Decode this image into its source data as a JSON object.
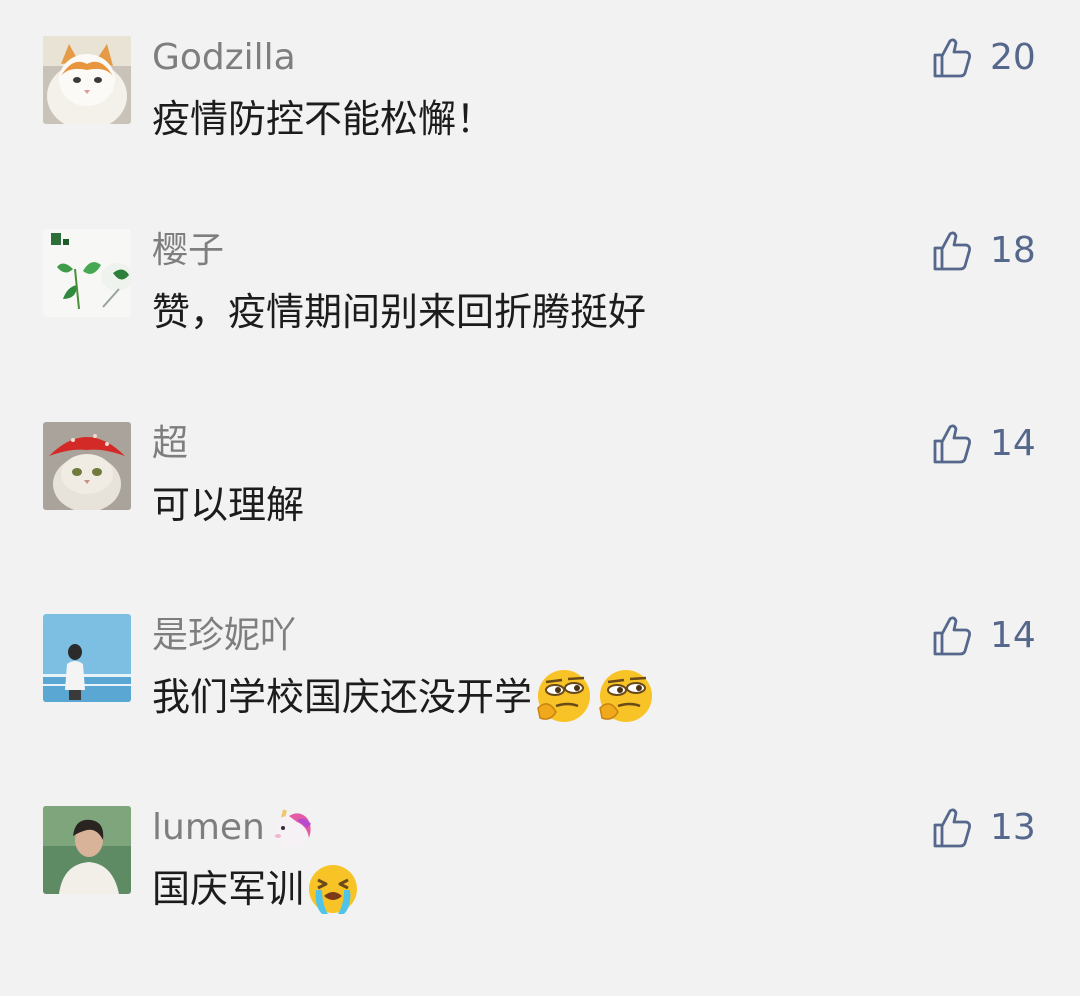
{
  "colors": {
    "background": "#f2f2f2",
    "username": "#7e7e7e",
    "comment_text": "#1c1c1c",
    "like": "#56678c"
  },
  "comments": [
    {
      "username": "Godzilla",
      "avatar": "orange-white-cat-photo",
      "text": "疫情防控不能松懈！",
      "likes": "20",
      "like_icon": "thumbs-up-icon"
    },
    {
      "username": "樱子",
      "avatar": "green-plant-leaves-photo",
      "text": "赞，疫情期间别来回折腾挺好",
      "likes": "18",
      "like_icon": "thumbs-up-icon"
    },
    {
      "username": "超",
      "avatar": "cat-with-red-bandana-photo",
      "text": "可以理解",
      "likes": "14",
      "like_icon": "thumbs-up-icon"
    },
    {
      "username": "是珍妮吖",
      "avatar": "girl-by-sea-illustration",
      "text": "我们学校国庆还没开学",
      "text_emojis": [
        "smirking-face-emoji",
        "smirking-face-emoji"
      ],
      "likes": "14",
      "like_icon": "thumbs-up-icon"
    },
    {
      "username": "lumen",
      "username_emoji": "unicorn-emoji",
      "avatar": "person-in-white-shirt-photo",
      "text": "国庆军训",
      "text_emojis": [
        "crying-face-emoji"
      ],
      "likes": "13",
      "like_icon": "thumbs-up-icon"
    }
  ]
}
